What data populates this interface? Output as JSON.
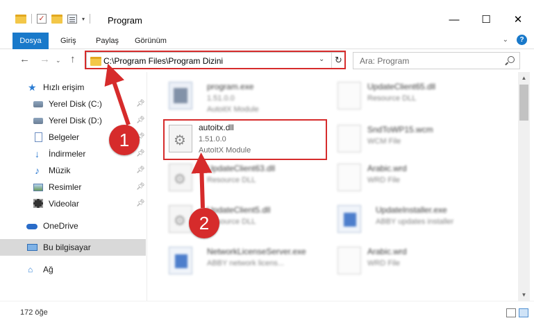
{
  "window": {
    "title": "Program",
    "controls": {
      "minimize": "—",
      "maximize": "☐",
      "close": "✕"
    }
  },
  "ribbon": {
    "tabs": [
      "Dosya",
      "Giriş",
      "Paylaş",
      "Görünüm"
    ],
    "help": "?"
  },
  "address": {
    "path": "C:\\Program Files\\Program Dizini",
    "search_placeholder": "Ara: Program"
  },
  "sidebar": {
    "items": [
      {
        "label": "Hızlı erişim",
        "icon": "star-icon"
      },
      {
        "label": "Yerel Disk (C:)",
        "icon": "drive-icon",
        "pinned": true
      },
      {
        "label": "Yerel Disk (D:)",
        "icon": "drive-icon",
        "pinned": true
      },
      {
        "label": "Belgeler",
        "icon": "documents-icon",
        "pinned": true
      },
      {
        "label": "İndirmeler",
        "icon": "downloads-icon",
        "pinned": true
      },
      {
        "label": "Müzik",
        "icon": "music-icon",
        "pinned": true
      },
      {
        "label": "Resimler",
        "icon": "pictures-icon",
        "pinned": true
      },
      {
        "label": "Videolar",
        "icon": "videos-icon",
        "pinned": true
      },
      {
        "label": "OneDrive",
        "icon": "onedrive-icon"
      },
      {
        "label": "Bu bilgisayar",
        "icon": "computer-icon",
        "selected": true
      },
      {
        "label": "Ağ",
        "icon": "network-icon"
      }
    ]
  },
  "files": [
    {
      "name": "program.exe",
      "line2": "1.51.0.0",
      "line3": "AutoitX Module",
      "icon": "exe-icon"
    },
    {
      "name": "UpdateClient65.dll",
      "line2": "Resource DLL",
      "line3": "",
      "icon": "page-icon"
    },
    {
      "name": "autoitx.dll",
      "line2": "1.51.0.0",
      "line3": "AutoItX Module",
      "icon": "dll-gear-icon",
      "highlighted": true
    },
    {
      "name": "SndToWP15.wcm",
      "line2": "WCM File",
      "line3": "",
      "icon": "page-icon"
    },
    {
      "name": "UpdateClient63.dll",
      "line2": "Resource DLL",
      "line3": "",
      "icon": "dll-gear-icon"
    },
    {
      "name": "Arabic.wrd",
      "line2": "WRD File",
      "line3": "",
      "icon": "page-icon"
    },
    {
      "name": "UpdateClient5.dll",
      "line2": "Resource DLL",
      "line3": "",
      "icon": "dll-gear-icon"
    },
    {
      "name": "UpdateInstaller.exe",
      "line2": "ABBY updates installer",
      "line3": "",
      "icon": "blue-app-icon"
    },
    {
      "name": "NetworkLicenseServer.exe",
      "line2": "ABBY network licens...",
      "line3": "",
      "icon": "blue-app-icon"
    },
    {
      "name": "Arabic.wrd",
      "line2": "WRD File",
      "line3": "",
      "icon": "page-icon"
    }
  ],
  "status": {
    "count": "172 öğe"
  },
  "annotations": {
    "step1": "1",
    "step2": "2",
    "color": "#d62b2b"
  }
}
